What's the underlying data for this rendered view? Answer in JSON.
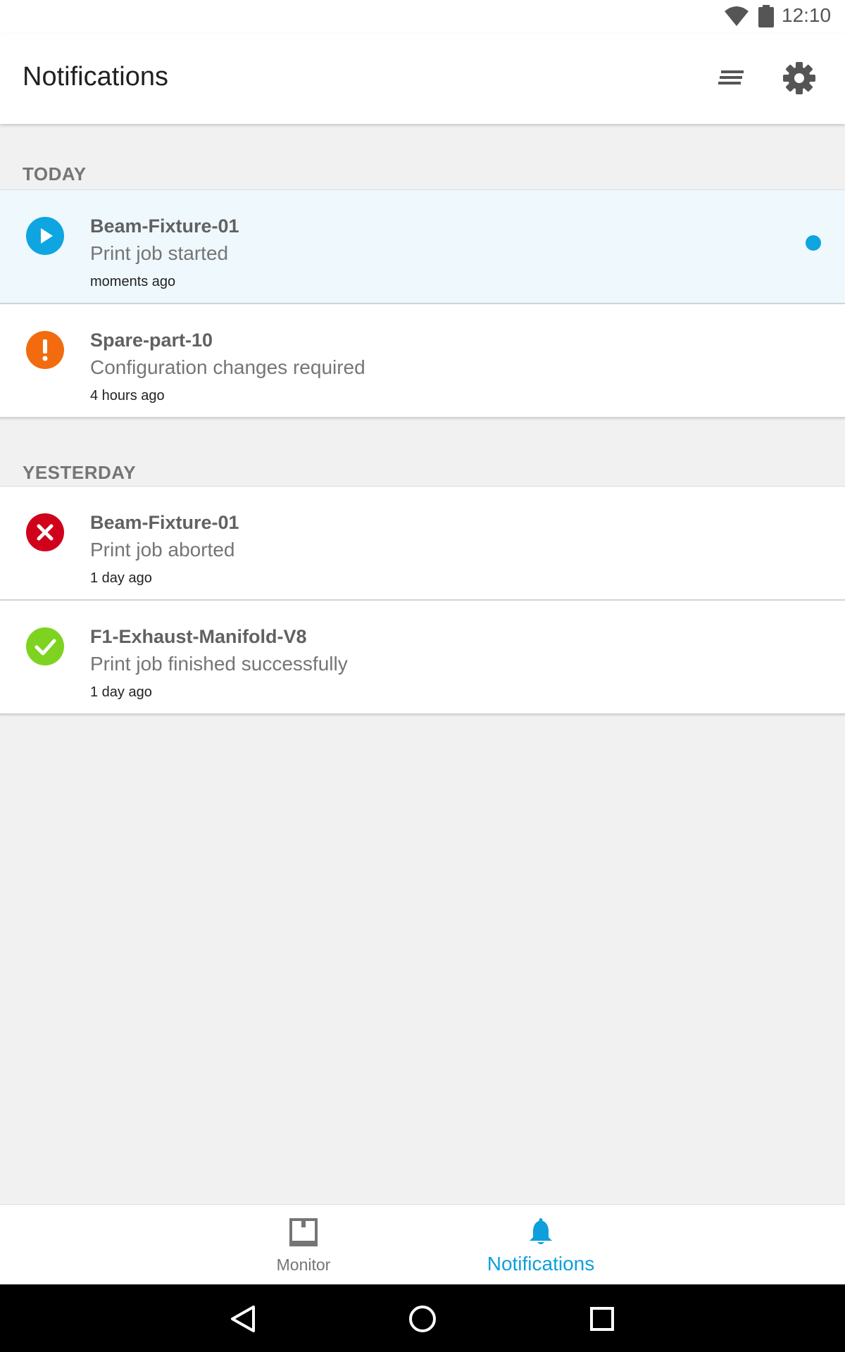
{
  "status_bar": {
    "time": "12:10"
  },
  "app_bar": {
    "title": "Notifications"
  },
  "sections": [
    {
      "header": "TODAY",
      "items": [
        {
          "name": "Beam-Fixture-01",
          "message": "Print job started",
          "time": "moments ago",
          "status": "started",
          "unread": true
        },
        {
          "name": "Spare-part-10",
          "message": "Configuration changes required",
          "time": "4 hours ago",
          "status": "warning",
          "unread": false
        }
      ]
    },
    {
      "header": "YESTERDAY",
      "items": [
        {
          "name": "Beam-Fixture-01",
          "message": "Print job aborted",
          "time": "1 day ago",
          "status": "aborted",
          "unread": false
        },
        {
          "name": "F1-Exhaust-Manifold-V8",
          "message": "Print job finished successfully",
          "time": "1 day ago",
          "status": "finished",
          "unread": false
        }
      ]
    }
  ],
  "bottom_nav": {
    "monitor_label": "Monitor",
    "notifications_label": "Notifications",
    "active": "notifications"
  },
  "colors": {
    "accent": "#0e9fdc",
    "started": "#0ea5e0",
    "warning": "#f26b0f",
    "aborted": "#d0021b",
    "finished": "#7ed321"
  },
  "icons": {
    "status_bar": [
      "wifi-icon",
      "battery-icon"
    ],
    "app_bar": [
      "filter-list-icon",
      "settings-gear-icon"
    ],
    "bottom_nav": [
      "printer-frame-icon",
      "bell-icon"
    ],
    "system_nav": [
      "back-icon",
      "home-icon",
      "recents-icon"
    ]
  }
}
